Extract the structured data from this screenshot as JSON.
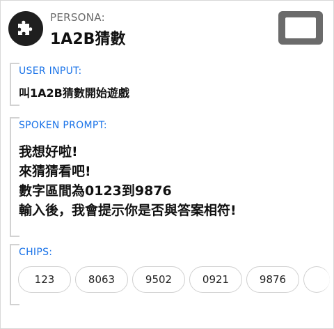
{
  "persona": {
    "label": "PERSONA:",
    "name": "1A2B猜數",
    "icon": "puzzle-icon",
    "display_icon": "display-icon"
  },
  "user_input": {
    "title": "USER INPUT:",
    "text": "叫1A2B猜數開始遊戲"
  },
  "spoken_prompt": {
    "title": "SPOKEN PROMPT:",
    "lines": [
      "我想好啦!",
      "來猜猜看吧!",
      "數字區間為0123到9876",
      "輸入後，我會提示你是否與答案相符!"
    ]
  },
  "chips": {
    "title": "CHIPS:",
    "items": [
      "123",
      "8063",
      "9502",
      "0921",
      "9876"
    ]
  },
  "colors": {
    "accent": "#1a73e8",
    "icon_dark": "#1f1f1f",
    "display_gray": "#6b6b6b"
  }
}
